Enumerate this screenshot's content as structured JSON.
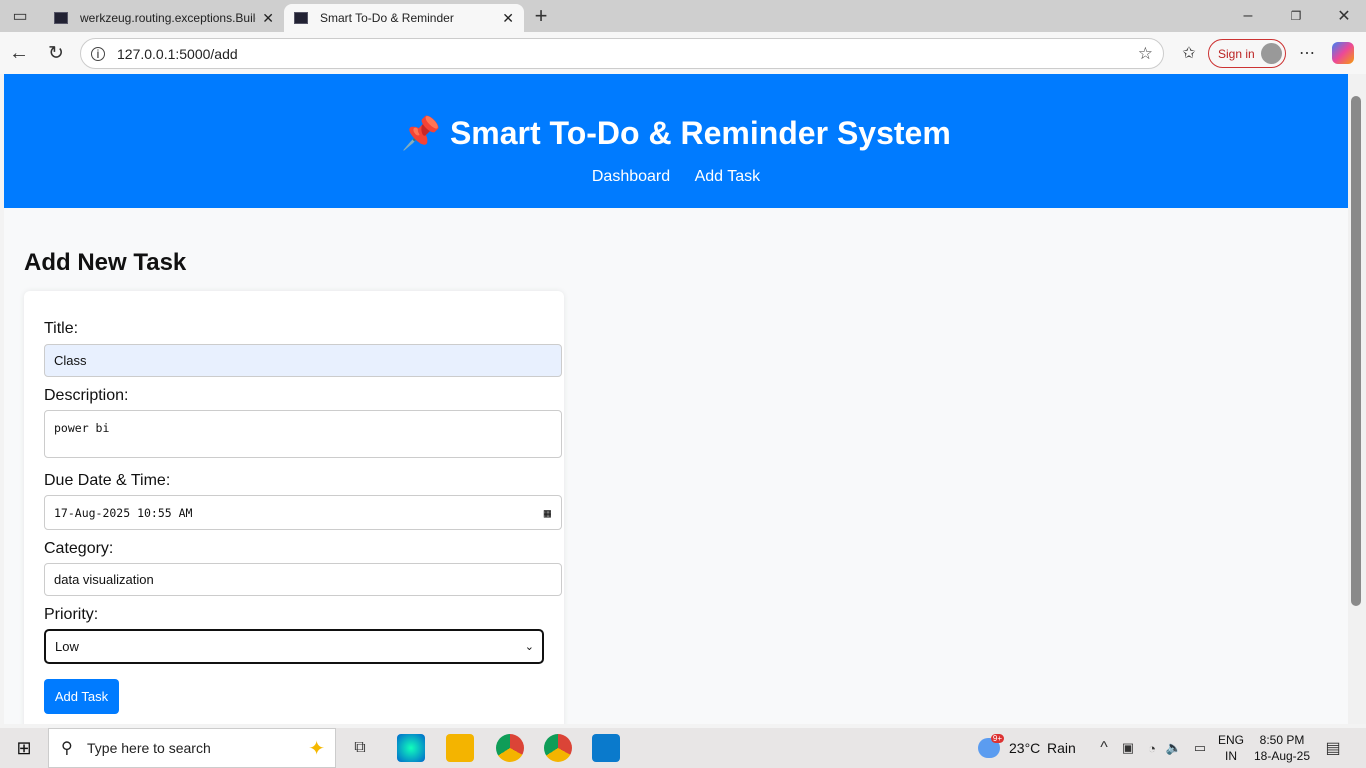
{
  "browser": {
    "tabs": [
      {
        "label": "werkzeug.routing.exceptions.BuildError"
      },
      {
        "label": "Smart To-Do & Reminder"
      }
    ],
    "url": "127.0.0.1:5000/add",
    "sign_in": "Sign in"
  },
  "header": {
    "icon": "📌",
    "title": "Smart To-Do & Reminder System",
    "nav": [
      {
        "label": "Dashboard"
      },
      {
        "label": "Add Task"
      }
    ]
  },
  "form": {
    "heading": "Add New Task",
    "title_label": "Title:",
    "title_value": "Class",
    "description_label": "Description:",
    "description_value": "power bi",
    "due_label": "Due Date & Time:",
    "due_value": "17-Aug-2025 10:55 AM",
    "category_label": "Category:",
    "category_value": "data visualization",
    "priority_label": "Priority:",
    "priority_value": "Low",
    "submit": "Add Task"
  },
  "taskbar": {
    "search_placeholder": "Type here to search",
    "weather_temp": "23°C",
    "weather_text": "Rain",
    "weather_badge": "9+",
    "lang1": "ENG",
    "lang2": "IN",
    "time": "8:50 PM",
    "date": "18-Aug-25"
  }
}
